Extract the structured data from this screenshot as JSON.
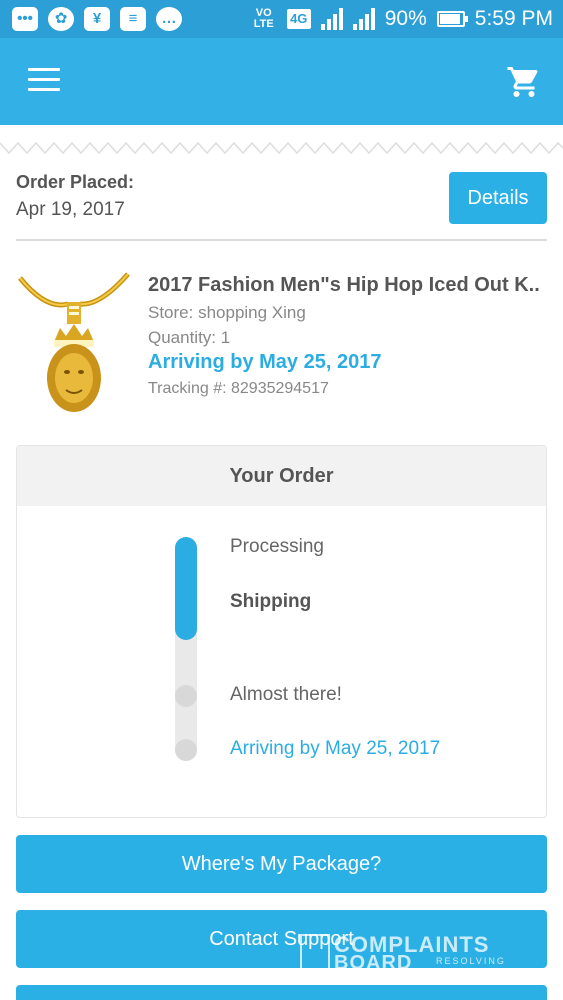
{
  "status_bar": {
    "network_label": "VO LTE",
    "network_type": "4G",
    "battery": "90%",
    "time": "5:59 PM"
  },
  "app_bar": {
    "menu_icon": "hamburger-menu-icon",
    "cart_icon": "shopping-cart-icon"
  },
  "order": {
    "placed_label": "Order Placed:",
    "placed_date": "Apr 19, 2017",
    "details_label": "Details"
  },
  "product": {
    "title": "2017 Fashion Men\"s Hip Hop Iced Out K..",
    "store": "Store: shopping Xing",
    "quantity": "Quantity: 1",
    "arriving": "Arriving by May 25, 2017",
    "tracking": "Tracking #: 82935294517"
  },
  "progress": {
    "title": "Your Order",
    "current_step": 2,
    "steps": [
      {
        "label": "Processing"
      },
      {
        "label": "Shipping"
      },
      {
        "label": "Almost there!"
      },
      {
        "label": "Arriving by May 25, 2017"
      }
    ]
  },
  "actions": {
    "wheres_package": "Where's My Package?",
    "contact_support": "Contact Support"
  },
  "watermark": {
    "line1": "COMPLAINTS",
    "line2": "BOARD",
    "line3": "RESOLVING"
  },
  "colors": {
    "status_bar": "#2b9fd6",
    "app_bar": "#33b0e6",
    "accent": "#2badE3"
  }
}
